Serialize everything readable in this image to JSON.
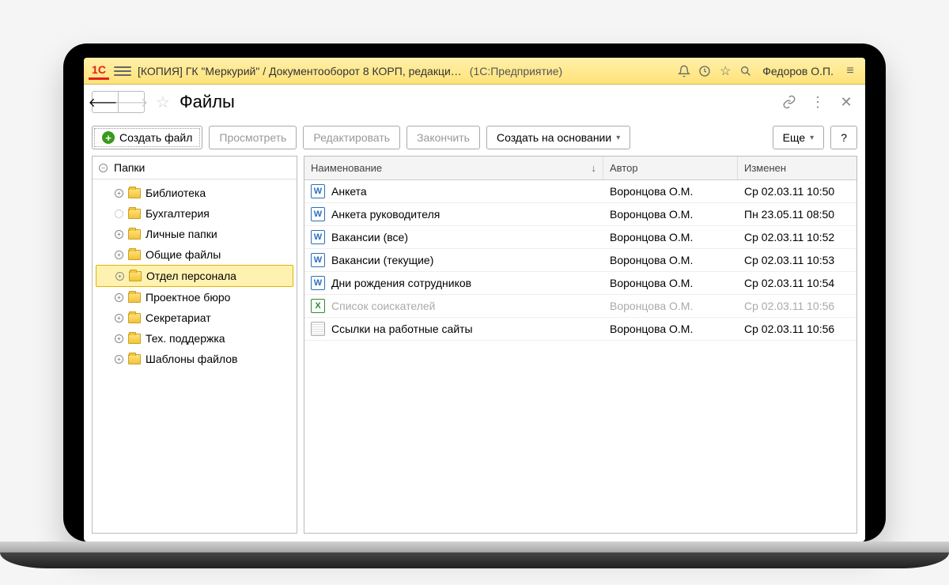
{
  "topbar": {
    "logo": "1C",
    "title": "[КОПИЯ] ГК \"Меркурий\" / Документооборот 8 КОРП, редакци…",
    "subtitle": "(1С:Предприятие)",
    "user": "Федоров О.П."
  },
  "page": {
    "title": "Файлы"
  },
  "toolbar": {
    "create": "Создать файл",
    "view": "Просмотреть",
    "edit": "Редактировать",
    "finish": "Закончить",
    "createFrom": "Создать на основании",
    "more": "Еще",
    "help": "?"
  },
  "tree": {
    "header": "Папки",
    "items": [
      {
        "label": "Библиотека",
        "expandable": true
      },
      {
        "label": "Бухгалтерия",
        "loading": true
      },
      {
        "label": "Личные папки",
        "expandable": true
      },
      {
        "label": "Общие файлы",
        "expandable": true
      },
      {
        "label": "Отдел персонала",
        "expandable": true,
        "selected": true
      },
      {
        "label": "Проектное бюро",
        "expandable": true
      },
      {
        "label": "Секретариат",
        "expandable": true
      },
      {
        "label": "Тех. поддержка",
        "expandable": true
      },
      {
        "label": "Шаблоны файлов",
        "expandable": true
      }
    ]
  },
  "table": {
    "columns": {
      "name": "Наименование",
      "author": "Автор",
      "changed": "Изменен"
    },
    "rows": [
      {
        "icon": "w",
        "name": "Анкета",
        "author": "Воронцова О.М.",
        "changed": "Ср 02.03.11 10:50"
      },
      {
        "icon": "w",
        "name": "Анкета руководителя",
        "author": "Воронцова О.М.",
        "changed": "Пн 23.05.11 08:50"
      },
      {
        "icon": "w",
        "name": "Вакансии (все)",
        "author": "Воронцова О.М.",
        "changed": "Ср 02.03.11 10:52"
      },
      {
        "icon": "w",
        "name": "Вакансии (текущие)",
        "author": "Воронцова О.М.",
        "changed": "Ср 02.03.11 10:53"
      },
      {
        "icon": "w",
        "name": "Дни рождения сотрудников",
        "author": "Воронцова О.М.",
        "changed": "Ср 02.03.11 10:54"
      },
      {
        "icon": "x",
        "name": "Список соискателей",
        "author": "Воронцова О.М.",
        "changed": "Ср 02.03.11 10:56",
        "dim": true
      },
      {
        "icon": "t",
        "name": "Ссылки на работные сайты",
        "author": "Воронцова О.М.",
        "changed": "Ср 02.03.11 10:56"
      }
    ]
  }
}
